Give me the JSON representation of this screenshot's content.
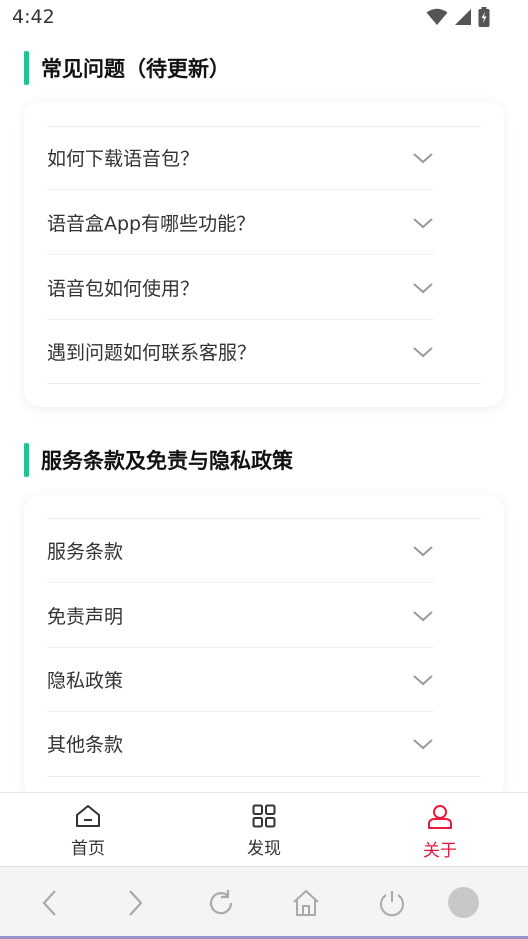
{
  "status": {
    "time": "4:42"
  },
  "faq": {
    "title": "常见问题（待更新）",
    "items": [
      {
        "label": "如何下载语音包？"
      },
      {
        "label": "语音盒App有哪些功能？"
      },
      {
        "label": "语音包如何使用？"
      },
      {
        "label": "遇到问题如何联系客服？"
      }
    ]
  },
  "terms": {
    "title": "服务条款及免责与隐私政策",
    "items": [
      {
        "label": "服务条款"
      },
      {
        "label": "免责声明"
      },
      {
        "label": "隐私政策"
      },
      {
        "label": "其他条款"
      }
    ]
  },
  "tabs": [
    {
      "label": "首页",
      "icon": "home-icon",
      "active": false
    },
    {
      "label": "发现",
      "icon": "grid-icon",
      "active": false
    },
    {
      "label": "关于",
      "icon": "user-icon",
      "active": true
    }
  ],
  "colors": {
    "accent": "#1fc38f",
    "active_tab": "#e8193c"
  }
}
